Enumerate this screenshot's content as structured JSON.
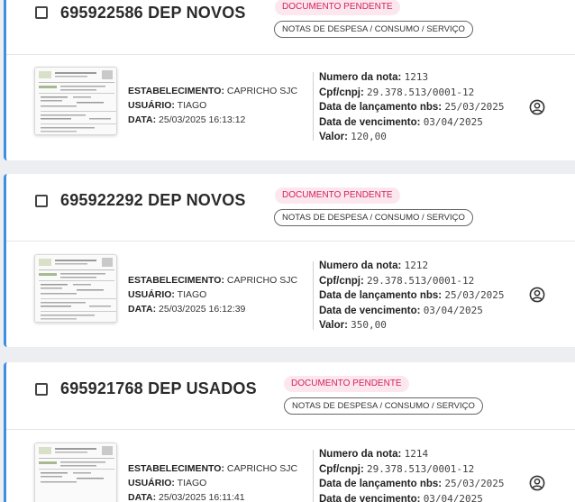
{
  "labels": {
    "estabelecimento": "ESTABELECIMENTO:",
    "usuario": "USUÁRIO:",
    "data": "DATA:",
    "numero": "Numero da nota:",
    "cpf": "Cpf/cnpj:",
    "lancamento": "Data de lançamento nbs:",
    "vencimento": "Data de vencimento:",
    "valor": "Valor:"
  },
  "cards": [
    {
      "title": "695922586 DEP NOVOS",
      "status": "DOCUMENTO PENDENTE",
      "category": "NOTAS DE DESPESA / CONSUMO / SERVIÇO",
      "estabelecimento": "CAPRICHO SJC",
      "usuario": "TIAGO",
      "data": "25/03/2025 16:13:12",
      "numero": "1213",
      "cpf": "29.378.513/0001-12",
      "lancamento": "25/03/2025",
      "vencimento": "03/04/2025",
      "valor": "120,00"
    },
    {
      "title": "695922292 DEP NOVOS",
      "status": "DOCUMENTO PENDENTE",
      "category": "NOTAS DE DESPESA / CONSUMO / SERVIÇO",
      "estabelecimento": "CAPRICHO SJC",
      "usuario": "TIAGO",
      "data": "25/03/2025 16:12:39",
      "numero": "1212",
      "cpf": "29.378.513/0001-12",
      "lancamento": "25/03/2025",
      "vencimento": "03/04/2025",
      "valor": "350,00"
    },
    {
      "title": "695921768 DEP USADOS",
      "status": "DOCUMENTO PENDENTE",
      "category": "NOTAS DE DESPESA / CONSUMO / SERVIÇO",
      "estabelecimento": "CAPRICHO SJC",
      "usuario": "TIAGO",
      "data": "25/03/2025 16:11:41",
      "numero": "1214",
      "cpf": "29.378.513/0001-12",
      "lancamento": "25/03/2025",
      "vencimento": "03/04/2025",
      "valor": ""
    }
  ],
  "icons": {
    "thumbnail": "document-thumbnail-icon",
    "user": "user-circle-icon",
    "select": "checkbox-icon"
  },
  "colors": {
    "accent": "#3d8fe0",
    "badge_bg": "#fde7ef",
    "badge_text": "#d0245a"
  }
}
